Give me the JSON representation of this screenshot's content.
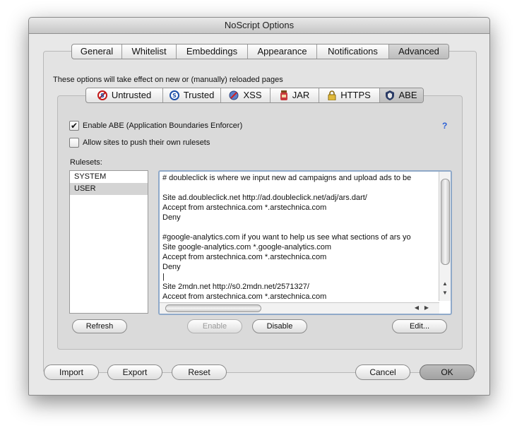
{
  "window": {
    "title": "NoScript Options"
  },
  "main_tabs": [
    {
      "label": "General"
    },
    {
      "label": "Whitelist"
    },
    {
      "label": "Embeddings"
    },
    {
      "label": "Appearance"
    },
    {
      "label": "Notifications"
    },
    {
      "label": "Advanced"
    }
  ],
  "notice": "These options will take effect on new or (manually) reloaded pages",
  "sub_tabs": [
    {
      "label": "Untrusted",
      "icon": "untrusted-icon"
    },
    {
      "label": "Trusted",
      "icon": "trusted-icon"
    },
    {
      "label": "XSS",
      "icon": "xss-icon"
    },
    {
      "label": "JAR",
      "icon": "jar-icon"
    },
    {
      "label": "HTTPS",
      "icon": "lock-icon"
    },
    {
      "label": "ABE",
      "icon": "abe-icon"
    }
  ],
  "abe": {
    "enable_label": "Enable ABE (Application Boundaries Enforcer)",
    "enable_checked": true,
    "allow_label": "Allow sites to push their own rulesets",
    "allow_checked": false,
    "help": "?",
    "rulesets_label": "Rulesets:",
    "rulesets": [
      "SYSTEM",
      "USER"
    ],
    "selected_ruleset": "USER",
    "code": "# doubleclick is where we input new ad campaigns and upload ads to be\n\nSite ad.doubleclick.net http://ad.doubleclick.net/adj/ars.dart/\nAccept from arstechnica.com *.arstechnica.com\nDeny\n\n#google-analytics.com if you want to help us see what sections of ars yo\nSite google-analytics.com *.google-analytics.com\nAccept from arstechnica.com *.arstechnica.com\nDeny\n|\nSite 2mdn.net http://s0.2mdn.net/2571327/\nAccept from arstechnica.com *.arstechnica.com"
  },
  "buttons": {
    "refresh": "Refresh",
    "enable": "Enable",
    "disable": "Disable",
    "edit": "Edit...",
    "import": "Import",
    "export": "Export",
    "reset": "Reset",
    "cancel": "Cancel",
    "ok": "OK"
  }
}
